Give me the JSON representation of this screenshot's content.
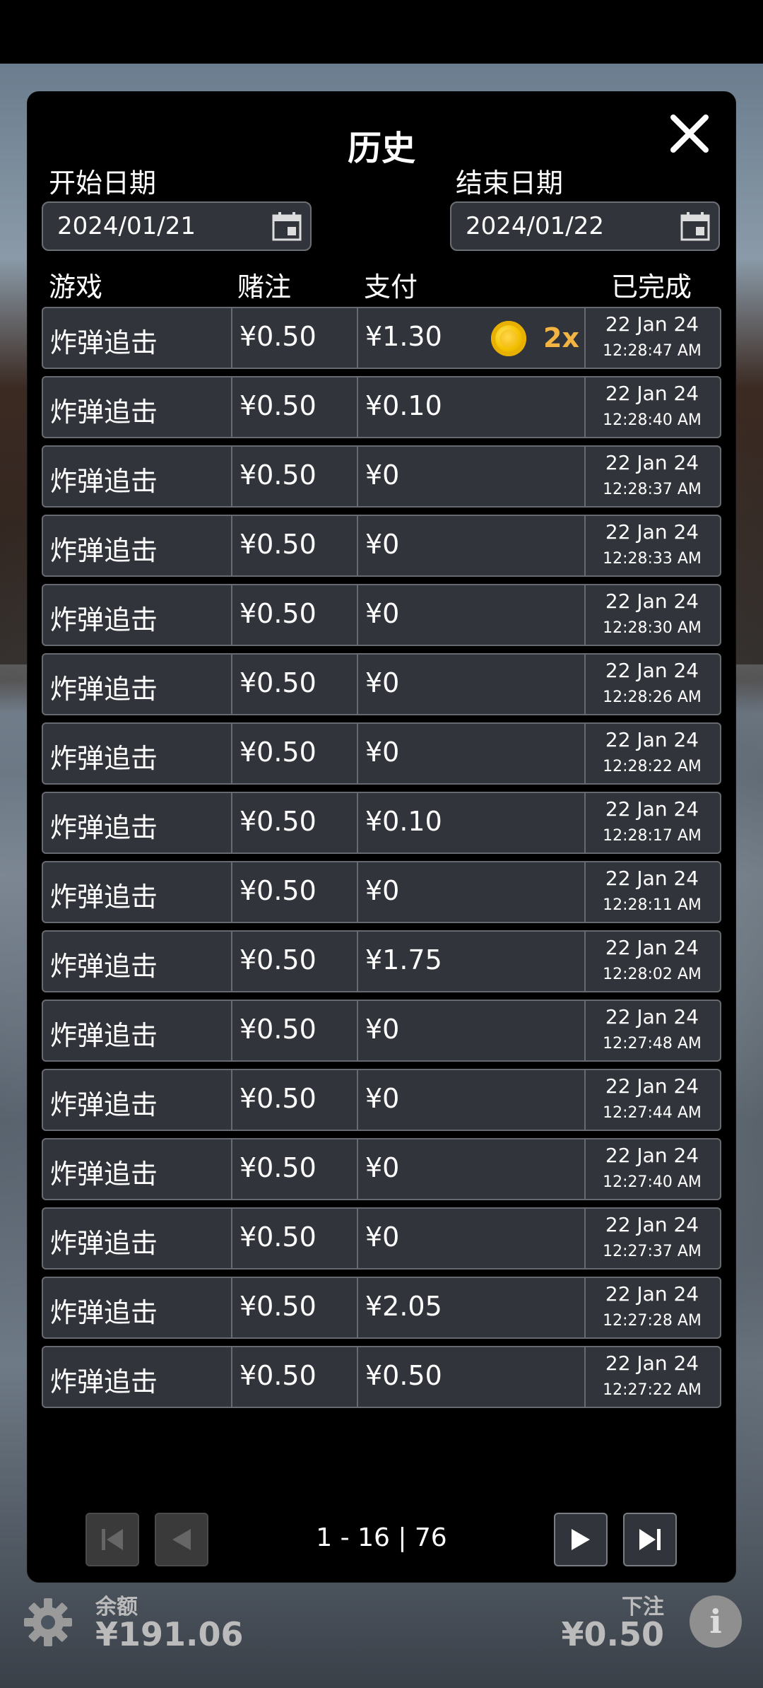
{
  "modal": {
    "title": "历史",
    "start_date_label": "开始日期",
    "start_date_value": "2024/01/21",
    "end_date_label": "结束日期",
    "end_date_value": "2024/01/22"
  },
  "table": {
    "headers": [
      "游戏",
      "赌注",
      "支付",
      "已完成"
    ],
    "rows": [
      {
        "game": "炸弹追击",
        "bet": "¥0.50",
        "pay": "¥1.30",
        "multiplier": "2x",
        "date": "22 Jan 24",
        "time": "12:28:47 AM"
      },
      {
        "game": "炸弹追击",
        "bet": "¥0.50",
        "pay": "¥0.10",
        "date": "22 Jan 24",
        "time": "12:28:40 AM"
      },
      {
        "game": "炸弹追击",
        "bet": "¥0.50",
        "pay": "¥0",
        "date": "22 Jan 24",
        "time": "12:28:37 AM"
      },
      {
        "game": "炸弹追击",
        "bet": "¥0.50",
        "pay": "¥0",
        "date": "22 Jan 24",
        "time": "12:28:33 AM"
      },
      {
        "game": "炸弹追击",
        "bet": "¥0.50",
        "pay": "¥0",
        "date": "22 Jan 24",
        "time": "12:28:30 AM"
      },
      {
        "game": "炸弹追击",
        "bet": "¥0.50",
        "pay": "¥0",
        "date": "22 Jan 24",
        "time": "12:28:26 AM"
      },
      {
        "game": "炸弹追击",
        "bet": "¥0.50",
        "pay": "¥0",
        "date": "22 Jan 24",
        "time": "12:28:22 AM"
      },
      {
        "game": "炸弹追击",
        "bet": "¥0.50",
        "pay": "¥0.10",
        "date": "22 Jan 24",
        "time": "12:28:17 AM"
      },
      {
        "game": "炸弹追击",
        "bet": "¥0.50",
        "pay": "¥0",
        "date": "22 Jan 24",
        "time": "12:28:11 AM"
      },
      {
        "game": "炸弹追击",
        "bet": "¥0.50",
        "pay": "¥1.75",
        "date": "22 Jan 24",
        "time": "12:28:02 AM"
      },
      {
        "game": "炸弹追击",
        "bet": "¥0.50",
        "pay": "¥0",
        "date": "22 Jan 24",
        "time": "12:27:48 AM"
      },
      {
        "game": "炸弹追击",
        "bet": "¥0.50",
        "pay": "¥0",
        "date": "22 Jan 24",
        "time": "12:27:44 AM"
      },
      {
        "game": "炸弹追击",
        "bet": "¥0.50",
        "pay": "¥0",
        "date": "22 Jan 24",
        "time": "12:27:40 AM"
      },
      {
        "game": "炸弹追击",
        "bet": "¥0.50",
        "pay": "¥0",
        "date": "22 Jan 24",
        "time": "12:27:37 AM"
      },
      {
        "game": "炸弹追击",
        "bet": "¥0.50",
        "pay": "¥2.05",
        "date": "22 Jan 24",
        "time": "12:27:28 AM"
      },
      {
        "game": "炸弹追击",
        "bet": "¥0.50",
        "pay": "¥0.50",
        "date": "22 Jan 24",
        "time": "12:27:22 AM"
      }
    ]
  },
  "pagination": {
    "info": "1 - 16 | 76",
    "first_enabled": false,
    "prev_enabled": false,
    "next_enabled": true,
    "last_enabled": true
  },
  "bottom_bar": {
    "balance_label": "余额",
    "balance_value": "¥191.06",
    "bet_label": "下注",
    "bet_value": "¥0.50",
    "info_icon": "i"
  },
  "icons": {
    "close": "close-icon",
    "calendar": "calendar-icon",
    "coin": "coin-icon",
    "first_page": "first-page-icon",
    "prev_page": "prev-page-icon",
    "next_page": "next-page-icon",
    "last_page": "last-page-icon",
    "settings": "gear-icon",
    "info": "info-icon"
  },
  "colors": {
    "modal_bg": "#000000",
    "row_bg": "#31343a",
    "row_border": "#676a70",
    "multiplier": "#f2b544",
    "coin": "#f5c400"
  }
}
